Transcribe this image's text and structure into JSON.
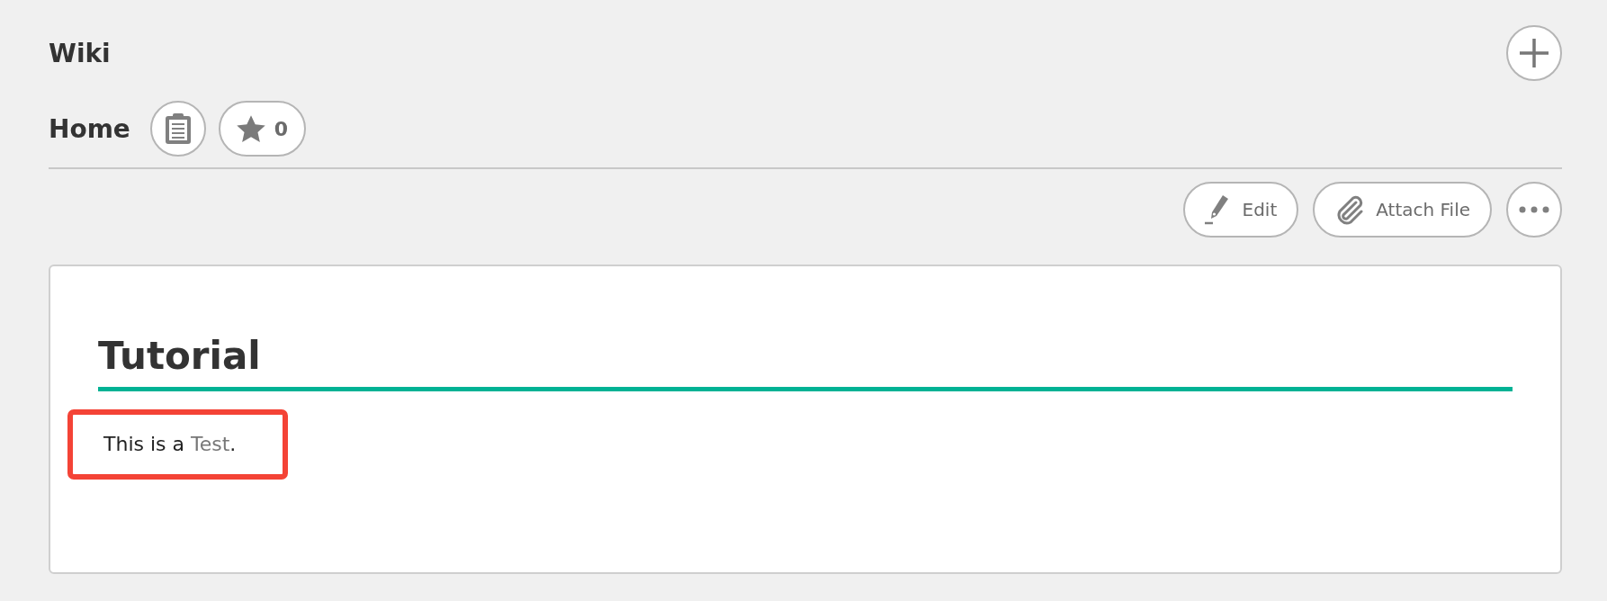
{
  "section_title": "Wiki",
  "page": {
    "title": "Home",
    "star_count": "0"
  },
  "toolbar": {
    "buttons": [
      {
        "label": "Edit"
      },
      {
        "label": "Attach File"
      }
    ]
  },
  "article": {
    "heading": "Tutorial",
    "paragraph": {
      "text_before": "This is a ",
      "link": "Test",
      "text_after": ".",
      "highlighted": true
    }
  }
}
